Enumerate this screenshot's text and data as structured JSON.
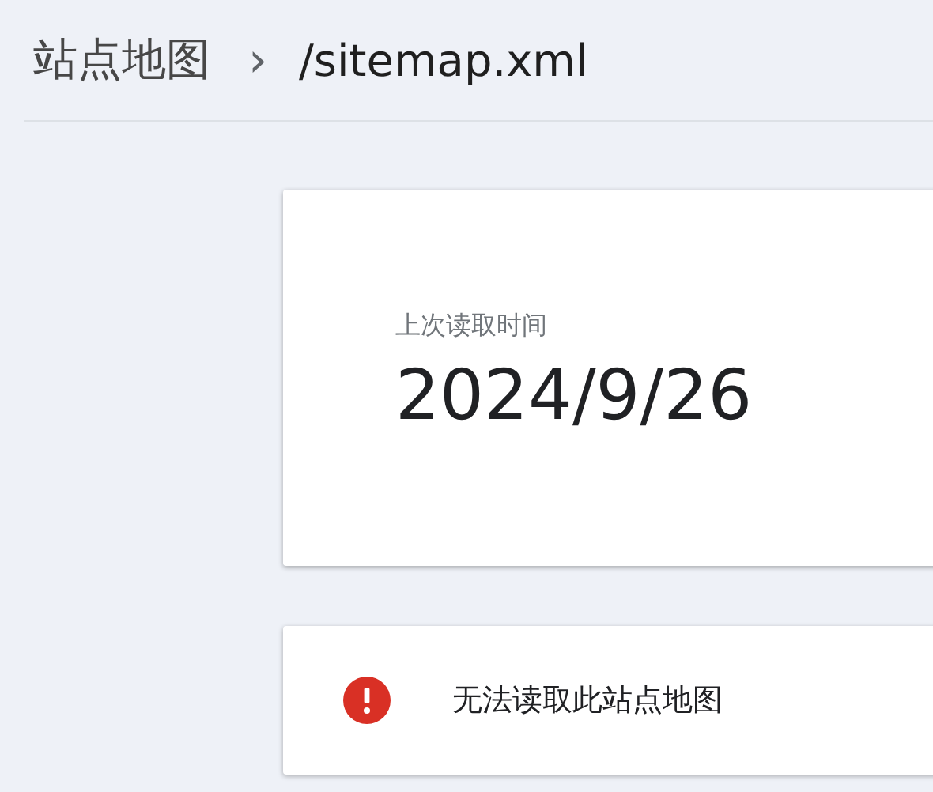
{
  "breadcrumb": {
    "parent": "站点地图",
    "separator": "›",
    "current": "/sitemap.xml"
  },
  "last_read": {
    "label": "上次读取时间",
    "value": "2024/9/26"
  },
  "status": {
    "kind": "error",
    "message": "无法读取此站点地图"
  }
}
